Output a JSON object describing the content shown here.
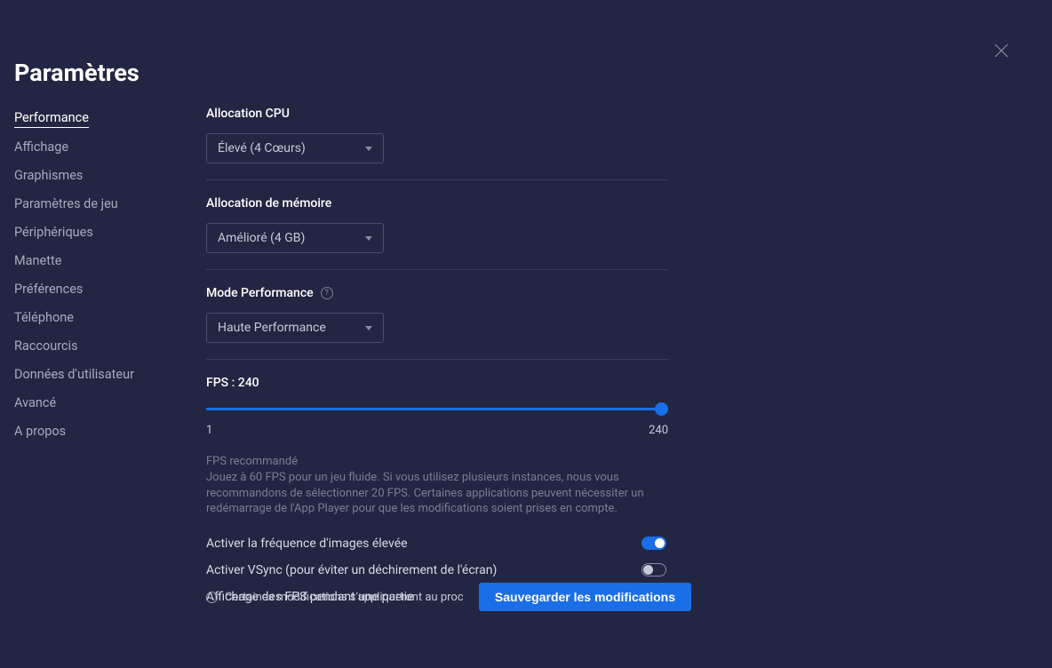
{
  "title": "Paramètres",
  "sidebar": {
    "items": [
      {
        "label": "Performance",
        "active": true
      },
      {
        "label": "Affichage",
        "active": false
      },
      {
        "label": "Graphismes",
        "active": false
      },
      {
        "label": "Paramètres de jeu",
        "active": false
      },
      {
        "label": "Périphériques",
        "active": false
      },
      {
        "label": "Manette",
        "active": false
      },
      {
        "label": "Préférences",
        "active": false
      },
      {
        "label": "Téléphone",
        "active": false
      },
      {
        "label": "Raccourcis",
        "active": false
      },
      {
        "label": "Données d'utilisateur",
        "active": false
      },
      {
        "label": "Avancé",
        "active": false
      },
      {
        "label": "A propos",
        "active": false
      }
    ]
  },
  "performance": {
    "cpu_label": "Allocation CPU",
    "cpu_value": "Élevé (4 Cœurs)",
    "mem_label": "Allocation de mémoire",
    "mem_value": "Amélioré (4 GB)",
    "mode_label": "Mode Performance",
    "mode_value": "Haute Performance",
    "fps_label": "FPS : 240",
    "fps_min": "1",
    "fps_max": "240",
    "fps_rec_title": "FPS recommandé",
    "fps_rec_text": "Jouez à 60 FPS pour un jeu fluide. Si vous utilisez plusieurs instances, nous vous recommandons de sélectionner 20 FPS. Certaines applications peuvent nécessiter un redémarrage de l'App Player pour que les modifications soient prises en compte.",
    "toggles": [
      {
        "label": "Activer la fréquence d'images élevée",
        "on": true
      },
      {
        "label": "Activer VSync (pour éviter un déchirement de l'écran)",
        "on": false
      },
      {
        "label": "Affichage des FPS pendant une partie",
        "on": false
      }
    ]
  },
  "footer": {
    "note": "Certaines modifications s'appliqueront au proch…",
    "save": "Sauvegarder les modifications"
  }
}
